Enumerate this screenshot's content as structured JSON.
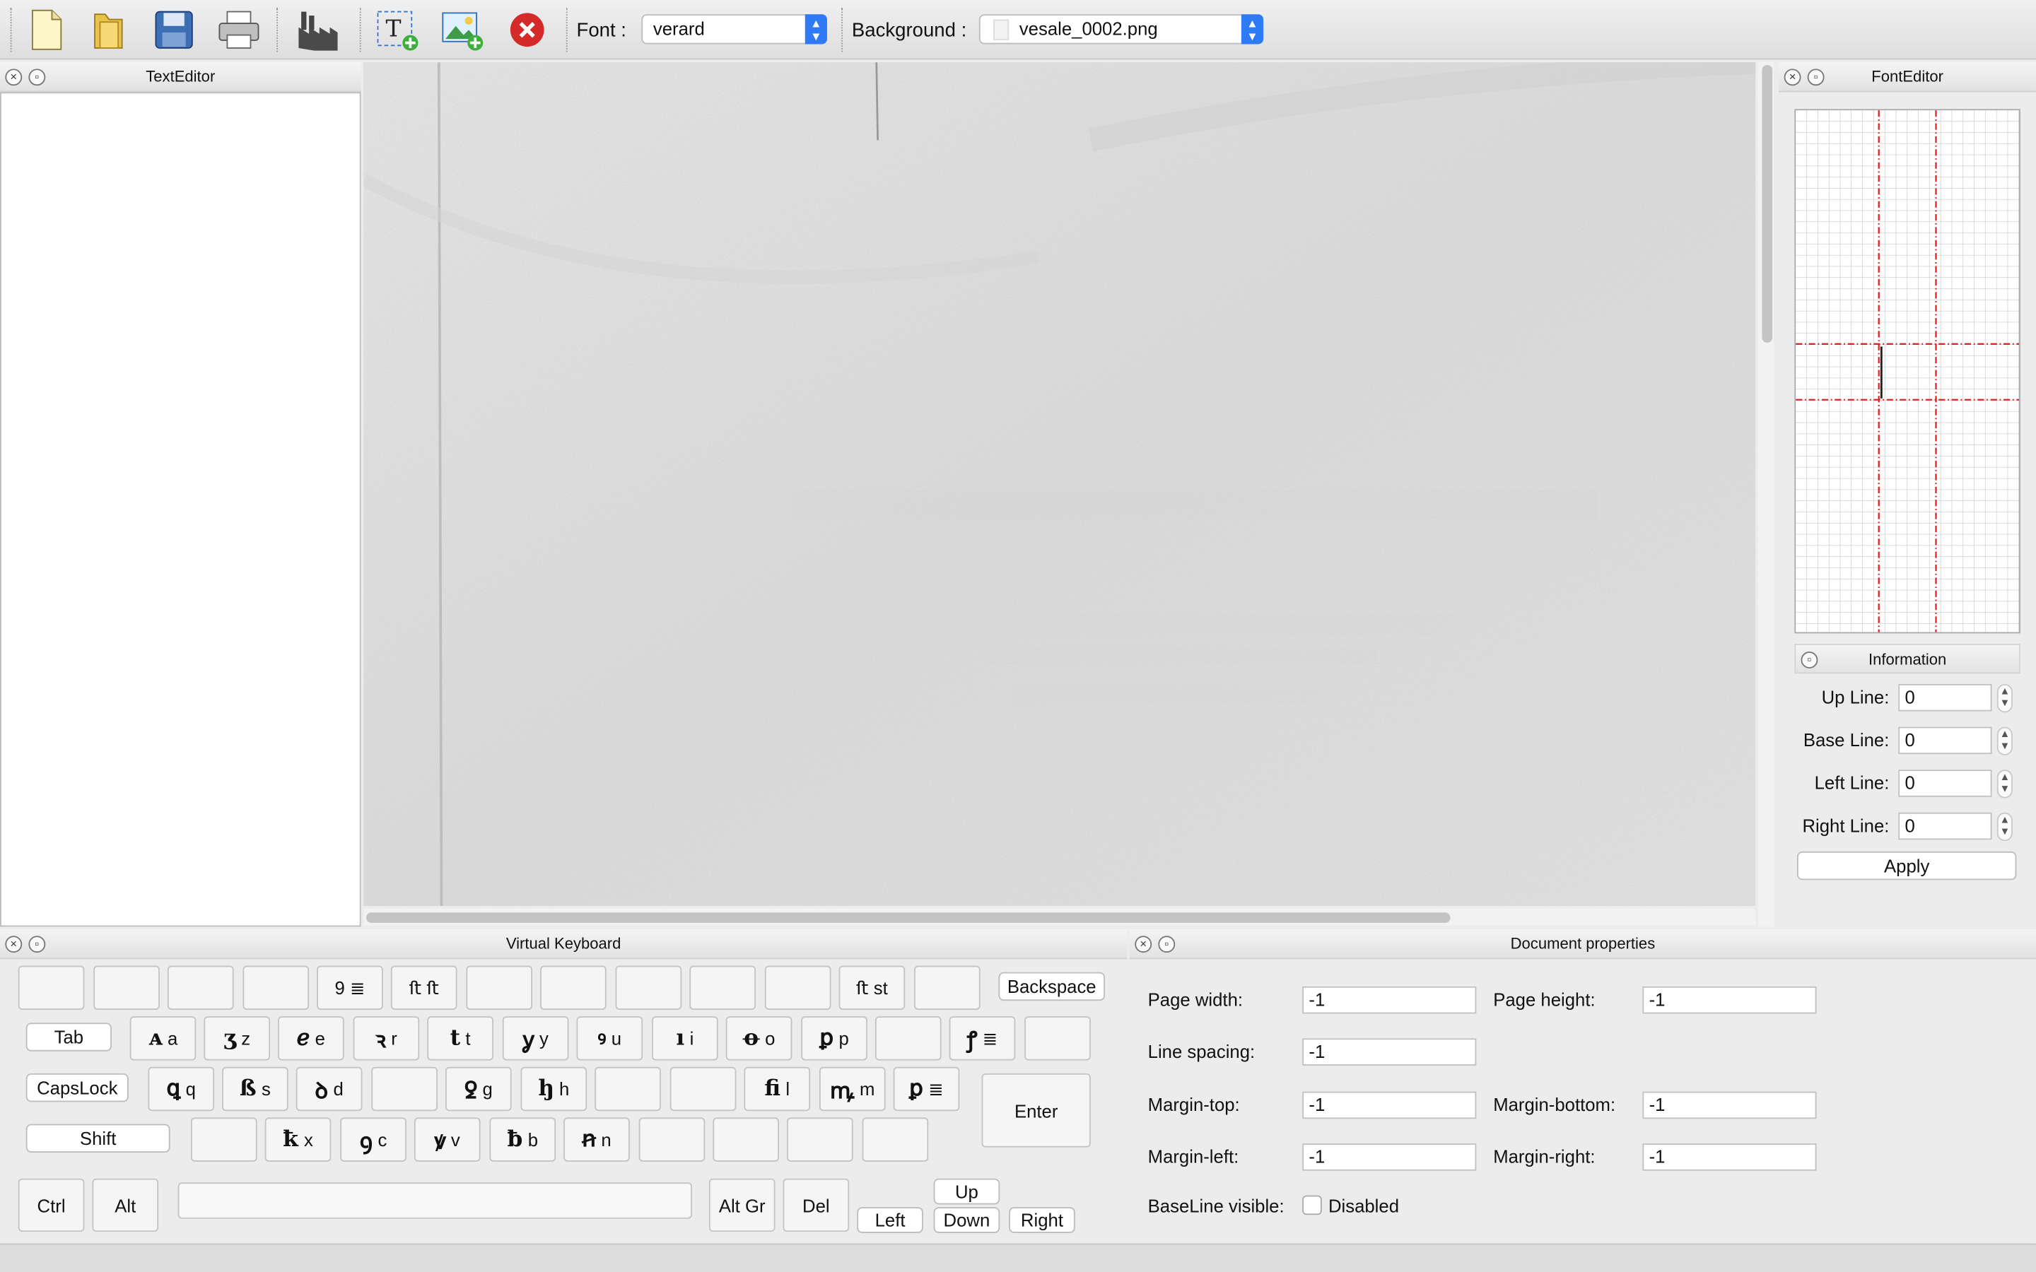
{
  "toolbar": {
    "font_label": "Font :",
    "font_value": "verard",
    "background_label": "Background :",
    "background_value": "vesale_0002.png",
    "icons": [
      "new-document-icon",
      "open-folder-icon",
      "save-icon",
      "print-icon",
      "factory-icon",
      "add-text-icon",
      "add-image-icon",
      "delete-icon"
    ]
  },
  "panels": {
    "text_editor": "TextEditor",
    "font_editor": "FontEditor",
    "information": "Information",
    "virtual_keyboard": "Virtual Keyboard",
    "document_properties": "Document properties"
  },
  "information": {
    "up_line_label": "Up Line:",
    "up_line": "0",
    "base_line_label": "Base Line:",
    "base_line": "0",
    "left_line_label": "Left Line:",
    "left_line": "0",
    "right_line_label": "Right Line:",
    "right_line": "0",
    "apply": "Apply"
  },
  "keyboard": {
    "row1": [
      "",
      "",
      "",
      "",
      "9 ≣",
      "ﬅ ﬅ",
      "",
      "",
      "",
      "",
      "",
      "ﬅ st",
      ""
    ],
    "backspace": "Backspace",
    "tab": "Tab",
    "row2": [
      "a",
      "z",
      "e",
      "r",
      "t",
      "y",
      "u",
      "i",
      "o",
      "p",
      "",
      "≣",
      ""
    ],
    "capslock": "CapsLock",
    "row3": [
      "q",
      "s",
      "d",
      "",
      "g",
      "h",
      "",
      "",
      "l",
      "m",
      "≣"
    ],
    "enter": "Enter",
    "shift": "Shift",
    "row4": [
      "",
      "x",
      "c",
      "v",
      "b",
      "n",
      "",
      "",
      "",
      ""
    ],
    "ctrl": "Ctrl",
    "alt": "Alt",
    "altgr": "Alt Gr",
    "del": "Del",
    "up": "Up",
    "left": "Left",
    "down": "Down",
    "right": "Right"
  },
  "document": {
    "page_width_label": "Page width:",
    "page_width": "-1",
    "page_height_label": "Page height:",
    "page_height": "-1",
    "line_spacing_label": "Line spacing:",
    "line_spacing": "-1",
    "margin_top_label": "Margin-top:",
    "margin_top": "-1",
    "margin_bottom_label": "Margin-bottom:",
    "margin_bottom": "-1",
    "margin_left_label": "Margin-left:",
    "margin_left": "-1",
    "margin_right_label": "Margin-right:",
    "margin_right": "-1",
    "baseline_visible_label": "BaseLine visible:",
    "baseline_visible": "Disabled"
  }
}
